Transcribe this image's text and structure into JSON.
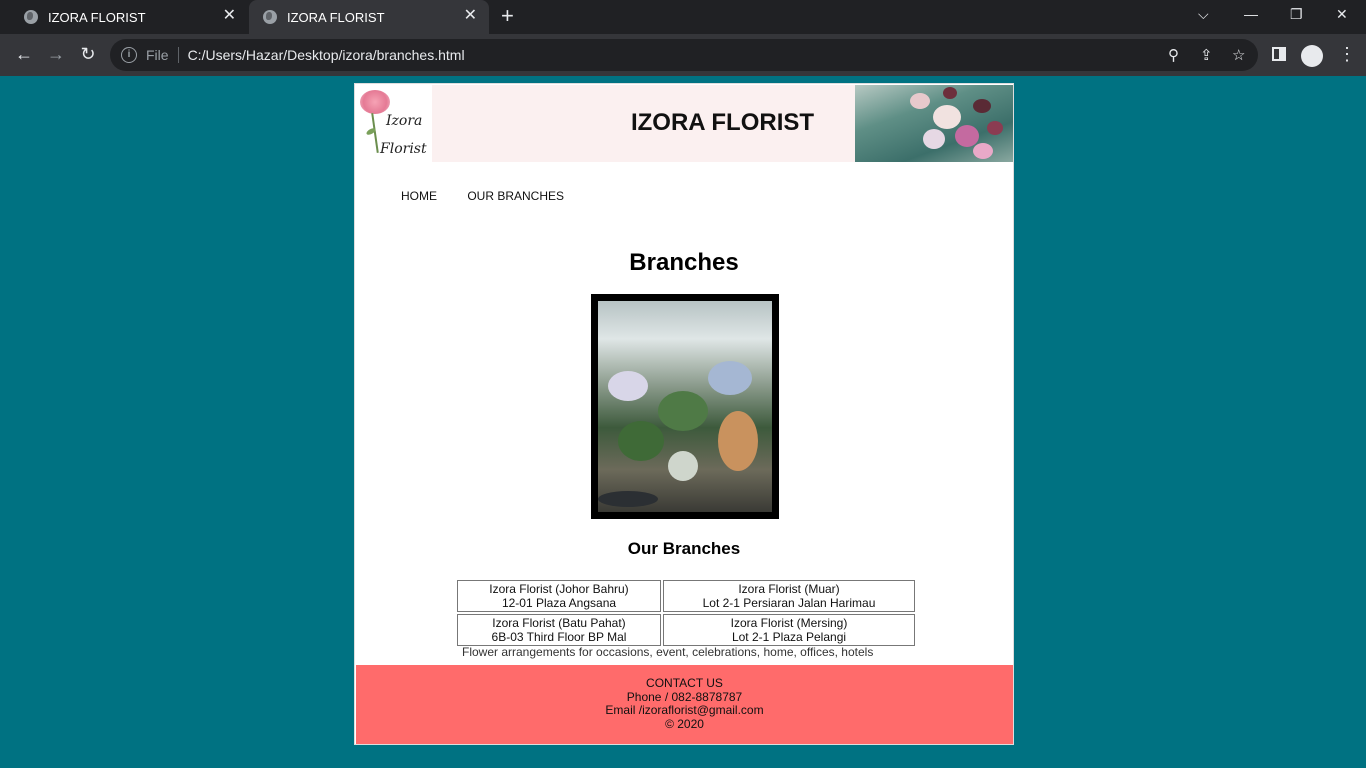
{
  "browser": {
    "tabs": [
      {
        "title": "IZORA FLORIST",
        "active": false
      },
      {
        "title": "IZORA FLORIST",
        "active": true
      }
    ],
    "address": {
      "scheme_label": "File",
      "url": "C:/Users/Hazar/Desktop/izora/branches.html"
    }
  },
  "site": {
    "logo": {
      "line1": "Izora",
      "line2": "Florist"
    },
    "title": "IZORA FLORIST",
    "nav": [
      "HOME",
      "OUR BRANCHES"
    ],
    "heading": "Branches",
    "subheading": "Our Branches",
    "branches": [
      [
        {
          "name": "Izora Florist (Johor Bahru)",
          "address": "12-01 Plaza Angsana"
        },
        {
          "name": "Izora Florist (Muar)",
          "address": "Lot 2-1 Persiaran Jalan Harimau"
        }
      ],
      [
        {
          "name": "Izora Florist (Batu Pahat)",
          "address": "6B-03 Third Floor BP Mal"
        },
        {
          "name": "Izora Florist (Mersing)",
          "address": "Lot 2-1 Plaza Pelangi"
        }
      ]
    ],
    "tagline": "Flower arrangements for occasions, event, celebrations, home, offices, hotels",
    "footer": {
      "title": "CONTACT US",
      "phone": "Phone / 082-8878787",
      "email": "Email /izoraflorist@gmail.com",
      "copyright": "© 2020"
    }
  },
  "colors": {
    "page_bg": "#007282",
    "footer_bg": "#ff6b6b",
    "header_bg": "#fbf0f0"
  }
}
